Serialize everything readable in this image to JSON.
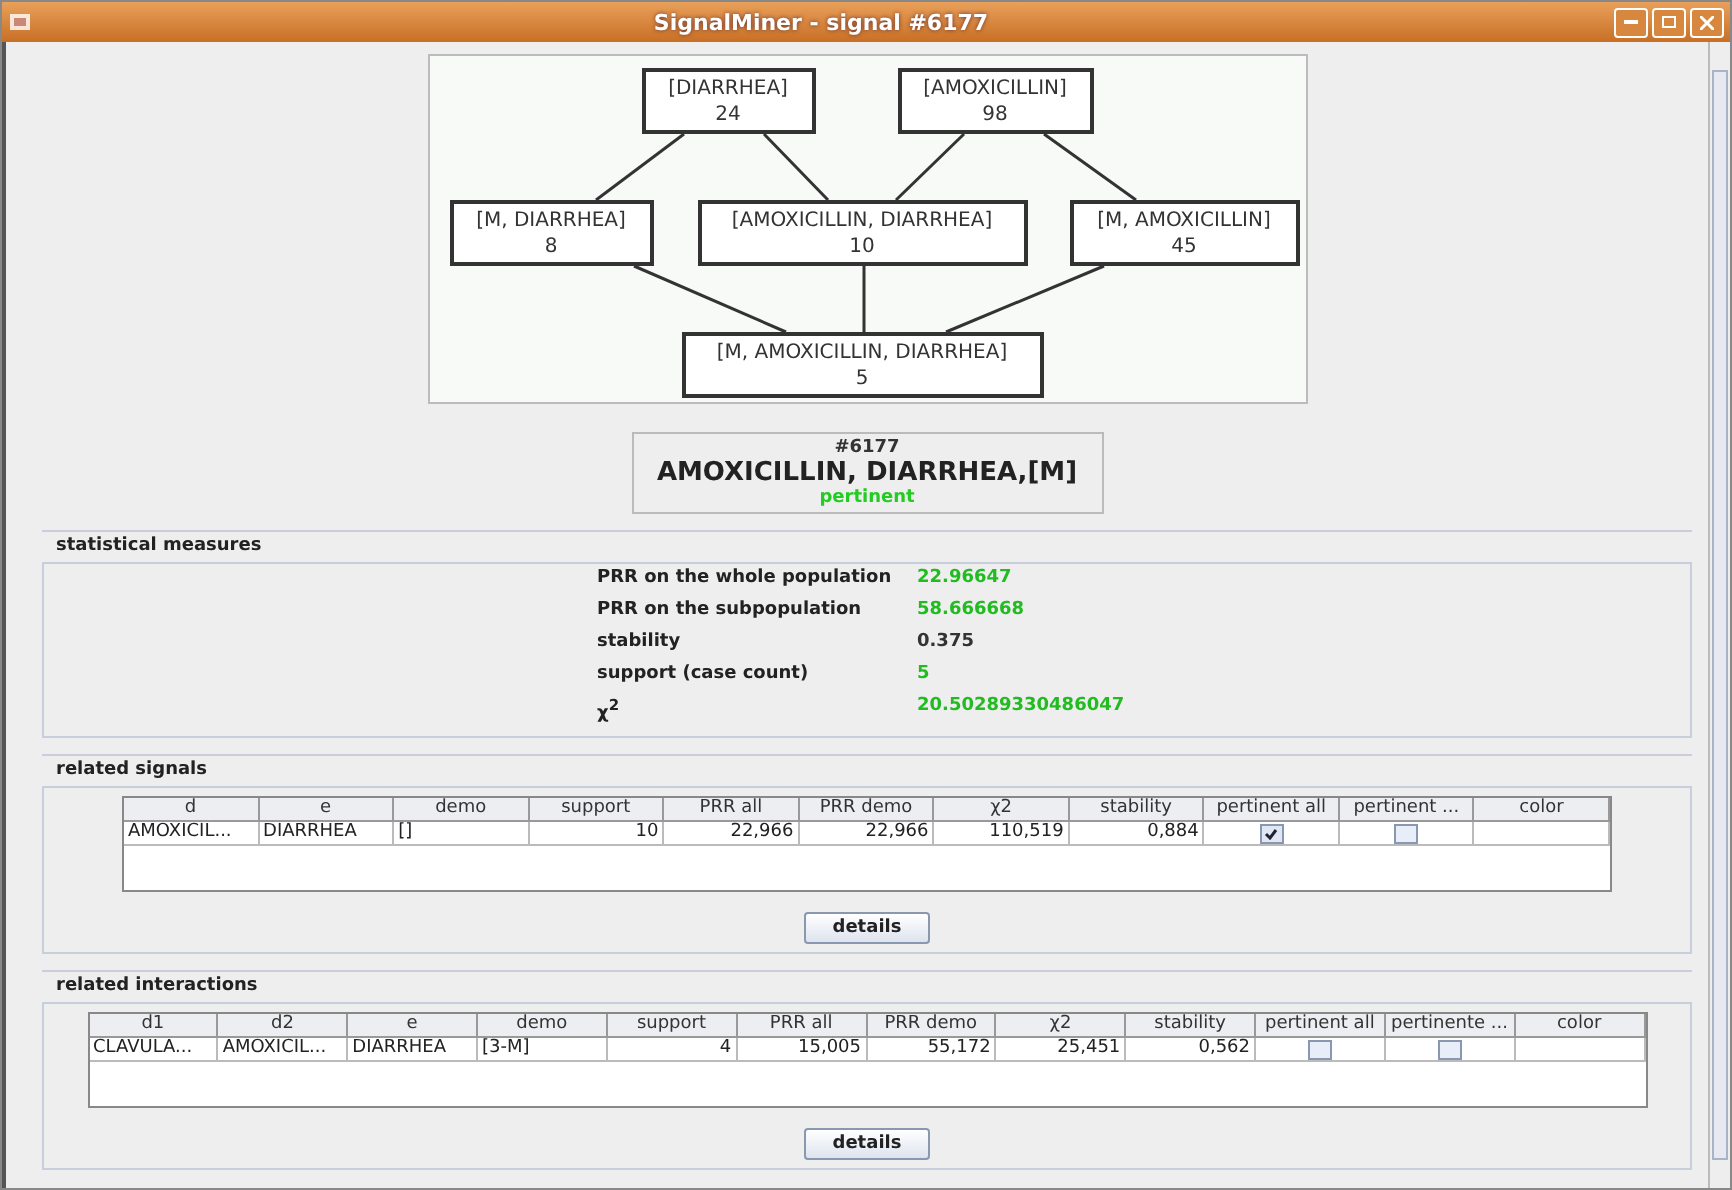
{
  "window": {
    "title": "SignalMiner - signal #6177"
  },
  "lattice": {
    "nodes": [
      {
        "label": "[DIARRHEA]",
        "count": "24"
      },
      {
        "label": "[AMOXICILLIN]",
        "count": "98"
      },
      {
        "label": "[M, DIARRHEA]",
        "count": "8"
      },
      {
        "label": "[AMOXICILLIN, DIARRHEA]",
        "count": "10"
      },
      {
        "label": "[M, AMOXICILLIN]",
        "count": "45"
      },
      {
        "label": "[M, AMOXICILLIN, DIARRHEA]",
        "count": "5"
      }
    ]
  },
  "signal": {
    "id": "#6177",
    "name": "AMOXICILLIN, DIARRHEA,[M]",
    "status": "pertinent"
  },
  "statistical_measures": {
    "title": "statistical measures",
    "rows": [
      {
        "label": "PRR on the whole population",
        "value": "22.96647",
        "highlight": true
      },
      {
        "label": "PRR on the subpopulation",
        "value": "58.666668",
        "highlight": true
      },
      {
        "label": "stability",
        "value": "0.375",
        "highlight": false
      },
      {
        "label": "support (case count)",
        "value": "5",
        "highlight": true
      },
      {
        "label": "χ$^{2}$",
        "value": "20.50289330486047",
        "highlight": true
      }
    ]
  },
  "related_signals": {
    "title": "related signals",
    "columns": [
      "d",
      "e",
      "demo",
      "support",
      "PRR all",
      "PRR demo",
      "χ2",
      "stability",
      "pertinent all",
      "pertinent ...",
      "color"
    ],
    "rows": [
      {
        "cells": [
          "AMOXICIL...",
          "DIARRHEA",
          "[]",
          "10",
          "22,966",
          "22,966",
          "110,519",
          "0,884"
        ],
        "pertinent_all": true,
        "pertinent_demo": false
      }
    ],
    "button": "details"
  },
  "related_interactions": {
    "title": "related interactions",
    "columns": [
      "d1",
      "d2",
      "e",
      "demo",
      "support",
      "PRR all",
      "PRR demo",
      "χ2",
      "stability",
      "pertinent all",
      "pertinente ...",
      "color"
    ],
    "rows": [
      {
        "cells": [
          "CLAVULA...",
          "AMOXICIL...",
          "DIARRHEA",
          "[3-M]",
          "4",
          "15,005",
          "55,172",
          "25,451",
          "0,562"
        ],
        "pertinent_all": false,
        "pertinent_demo": false
      }
    ],
    "button": "details"
  }
}
